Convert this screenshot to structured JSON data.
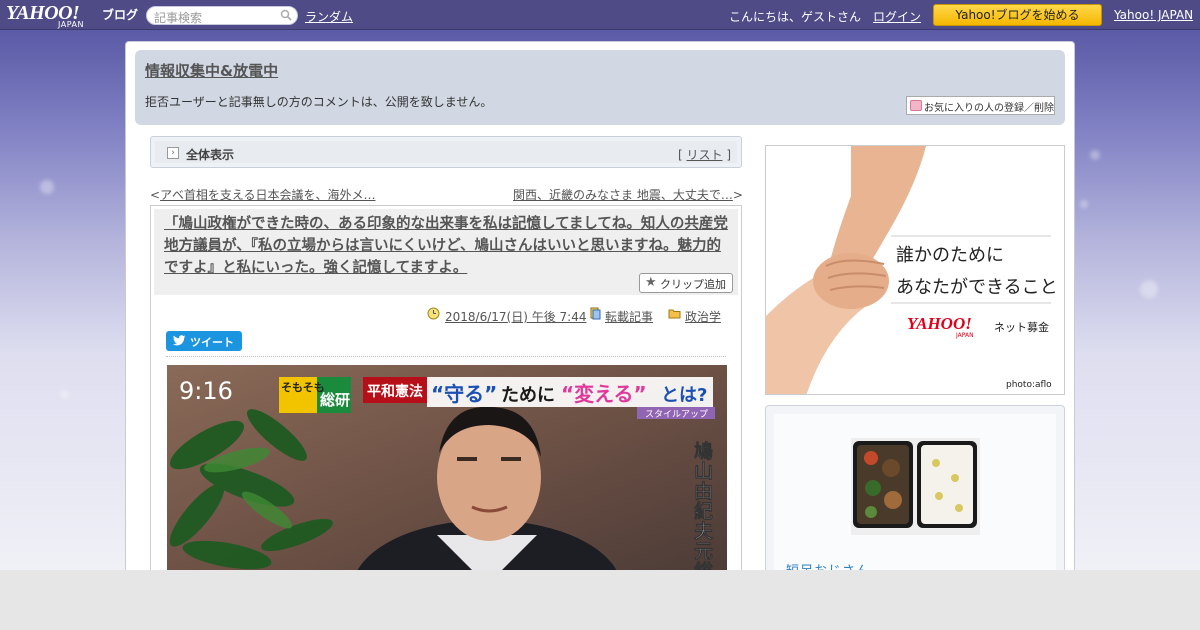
{
  "topbar": {
    "logo": {
      "main": "YAHOO!",
      "sub": "JAPAN",
      "product": "ブログ"
    },
    "search_placeholder": "記事検索",
    "random_link": "ランダム",
    "greeting": "こんにちは、ゲストさん",
    "login_link": "ログイン",
    "start_button": "Yahoo!ブログを始める",
    "yahoo_japan_link": "Yahoo! JAPAN"
  },
  "blog": {
    "title": "情報収集中&放電中",
    "description": "拒否ユーザーと記事無しの方のコメントは、公開を致しません。",
    "favorite_button": "お気に入りの人の登録／削除"
  },
  "view_bar": {
    "label": "全体表示",
    "list_open": "[ ",
    "list_link": "リスト",
    "list_close": " ]"
  },
  "nav": {
    "prev_marker": "<",
    "prev_title": "アベ首相を支える日本会議を、海外メ…",
    "next_title": "関西、近畿のみなさま 地震、大丈夫で…",
    "next_marker": ">"
  },
  "article": {
    "title": "「鳩山政権ができた時の、ある印象的な出来事を私は記憶してましてね。知人の共産党地方議員が、『私の立場からは言いにくいけど、鳩山さんはいいと思いますね。魅力的ですよ』と私にいった。強く記憶してますよ。",
    "clip_button": "クリップ追加",
    "date": "2018/6/17(日) 午後 7:44",
    "repost_link": "転載記事",
    "category_link": "政治学",
    "tweet_button": "ツイート",
    "photo": {
      "clock": "9:16",
      "corner_a": "そもそも",
      "corner_b": "総研",
      "tag": "平和憲法",
      "headline_q1": "“守る”",
      "headline_mid": "ために",
      "headline_q2": "“変える”",
      "headline_end": "とは?",
      "style_up": "スタイルアップ",
      "caption": "鳩山由紀夫元総理大"
    }
  },
  "ad": {
    "line1": "誰かのために",
    "line2": "あなたができること",
    "brand": "YAHOO!",
    "brand_sub": "JAPAN",
    "service": "ネット募金",
    "credit": "photo:aflo"
  },
  "profile": {
    "name": "短足おじさん"
  },
  "colors": {
    "topbar": "#4e4b86",
    "start_button": "#f5b700",
    "header_bg": "#d1d8e3",
    "tweet": "#1b95e0",
    "ad_red": "#e0001a",
    "profile_link": "#2a7fc4"
  }
}
